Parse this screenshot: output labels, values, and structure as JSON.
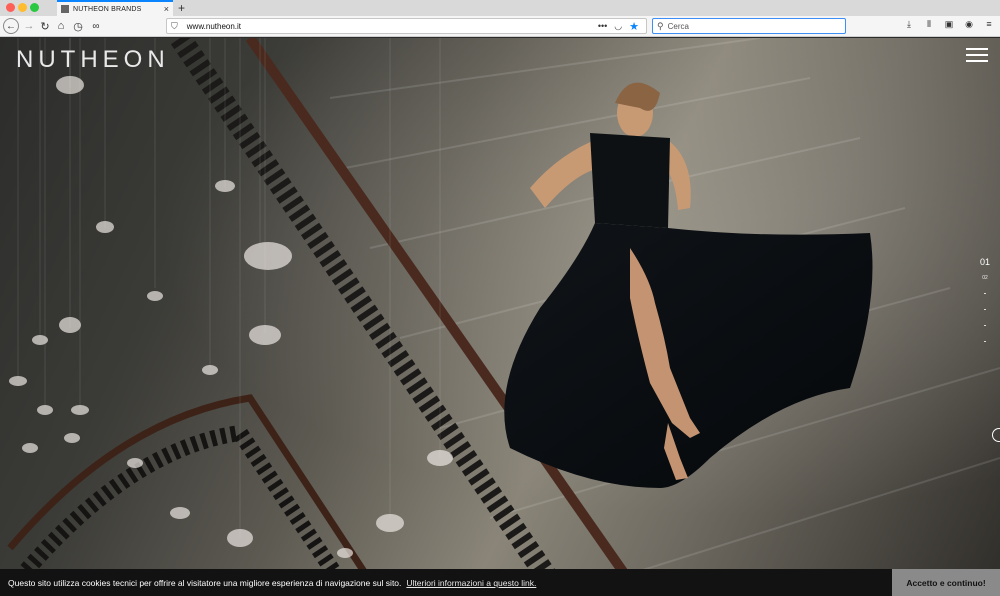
{
  "browser": {
    "tab_title": "NUTHEON BRANDS",
    "tab_close": "×",
    "new_tab": "+",
    "url": "www.nutheon.it",
    "page_actions": "•••",
    "search_placeholder": "Cerca"
  },
  "page": {
    "brand": "NUTHEON",
    "slide_current": "01",
    "slide_next": "02"
  },
  "cookie": {
    "message": "Questo sito utilizza cookies tecnici per offrire al visitatore una migliore esperienza di navigazione sul sito.",
    "link": "Ulteriori informazioni a questo link.",
    "accept": "Accetto e continuo!"
  },
  "colors": {
    "accent": "#0a84ff",
    "cookie_bg": "#121212",
    "accept_bg": "#8a8a8a"
  }
}
